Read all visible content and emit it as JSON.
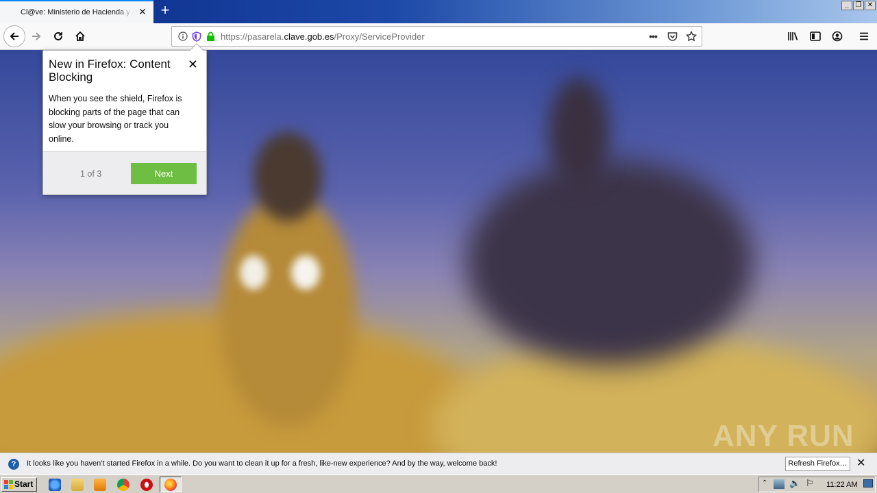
{
  "browser": {
    "tab_title": "Cl@ve: Ministerio de Hacienda y Administraciones Públicas",
    "url_prefix": "https://pasarela.",
    "url_domain": "clave.gob.es",
    "url_path": "/Proxy/ServiceProvider",
    "icons": [
      "back-icon",
      "forward-icon",
      "reload-icon",
      "home-icon",
      "info-icon",
      "shield-icon",
      "lock-icon",
      "page-actions-icon",
      "pocket-icon",
      "bookmark-star-icon",
      "library-icon",
      "sidebar-icon",
      "account-icon",
      "menu-icon"
    ]
  },
  "popup": {
    "title": "New in Firefox: Content Blocking",
    "body": "When you see the shield, Firefox is blocking parts of the page that can slow your browsing or track you online.",
    "pager": "1 of 3",
    "next_label": "Next",
    "accent": "#6fbe44"
  },
  "notification": {
    "text": "It looks like you haven’t started Firefox in a while. Do you want to clean it up for a fresh, like-new experience? And by the way, welcome back!",
    "button_label": "Refresh Firefox…"
  },
  "taskbar": {
    "start_label": "Start",
    "clock": "11:22 AM"
  },
  "watermark": "ANY RUN"
}
